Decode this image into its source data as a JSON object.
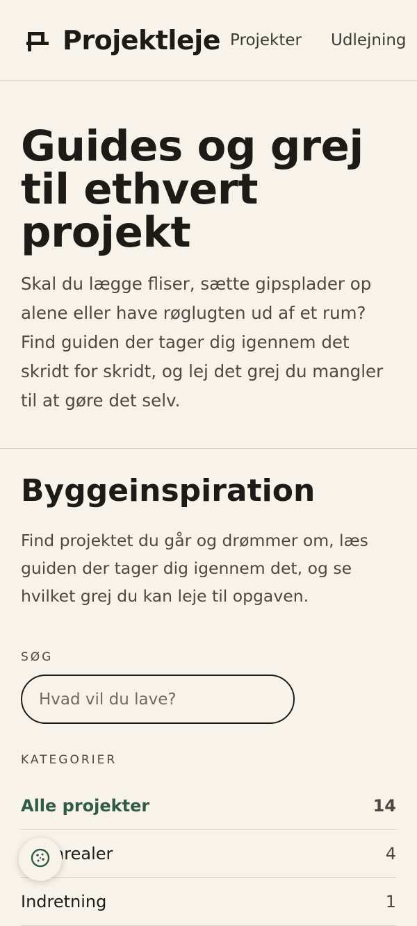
{
  "header": {
    "brand": "Projektleje",
    "brand_icon": "hammer-icon",
    "nav": [
      "Projekter",
      "Udlejning"
    ]
  },
  "hero": {
    "title": "Guides og grej til ethvert projekt",
    "text": "Skal du lægge fliser, sætte gipsplader op alene eller have røglugten ud af et rum? Find guiden der tager dig igennem det skridt for skridt, og lej det grej du mangler til at gøre det selv."
  },
  "inspiration": {
    "title": "Byggeinspiration",
    "text": "Find projektet du går og drømmer om, læs guiden der tager dig igennem det, og se hvilket grej du kan leje til opgaven.",
    "search_label": "SØG",
    "search_placeholder": "Hvad vil du lave?",
    "categories_label": "KATEGORIER",
    "categories": [
      {
        "name": "Alle projekter",
        "count": "14",
        "active": true
      },
      {
        "name": "Udearealer",
        "count": "4"
      },
      {
        "name": "Indretning",
        "count": "1"
      }
    ]
  },
  "cookie_button": {
    "icon": "cookie-icon"
  },
  "colors": {
    "background": "#f7f3ea",
    "accent": "#2f5a46",
    "text": "#1c1b18"
  }
}
